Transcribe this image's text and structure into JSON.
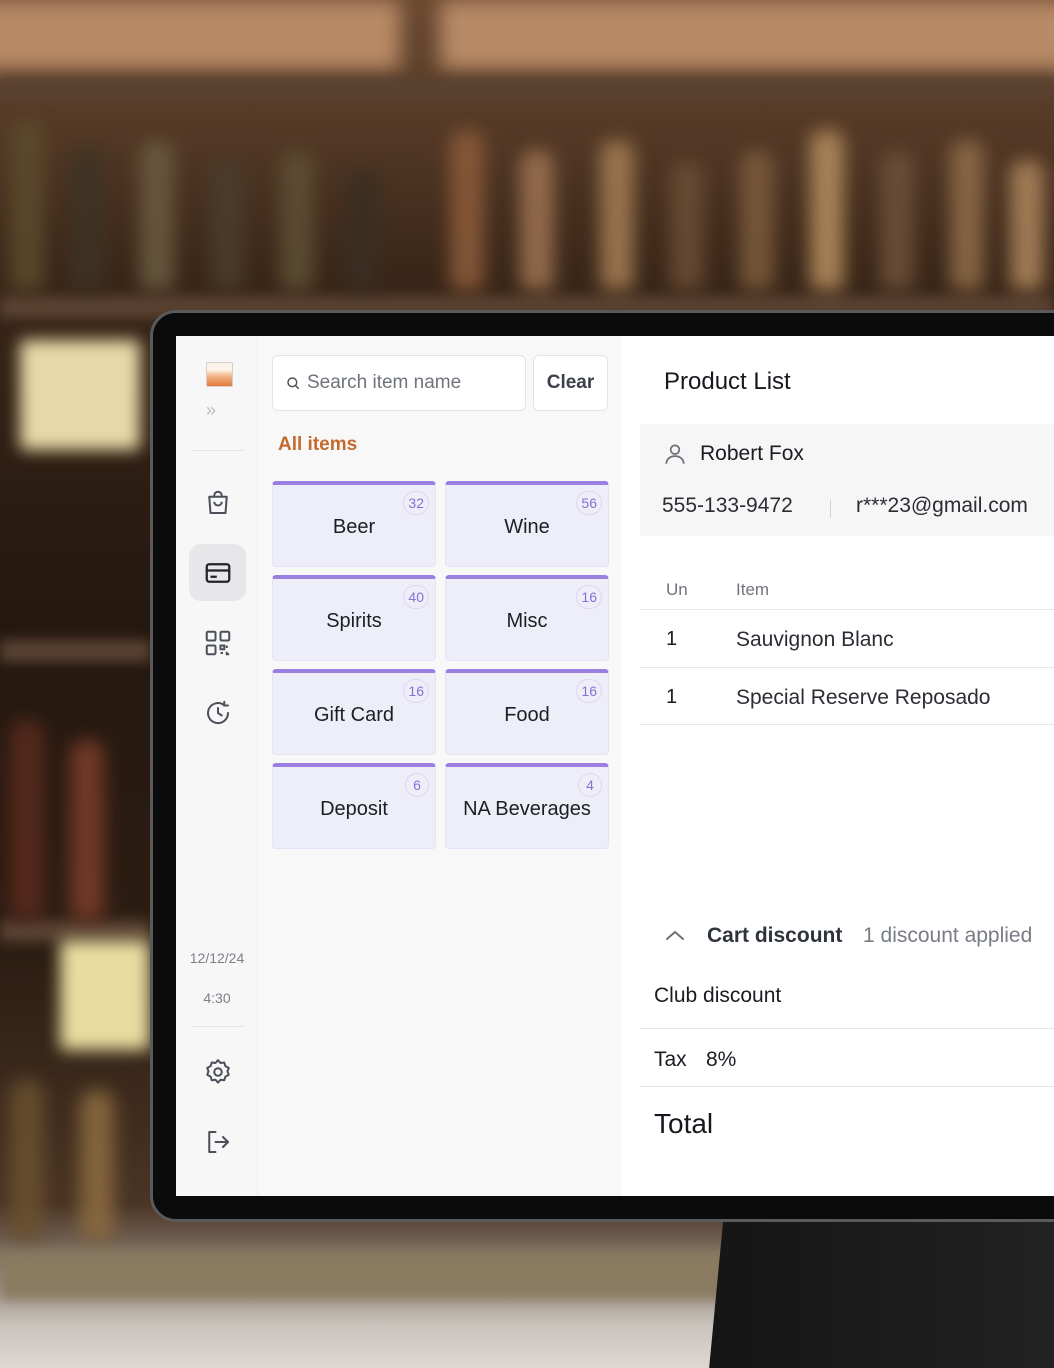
{
  "colors": {
    "accent_orange": "#c56a2e",
    "tile_border_purple": "#9a7fe0",
    "tile_bg": "#eeeef8",
    "badge_text": "#8a6fd6"
  },
  "rail": {
    "logo": "app-logo",
    "expand_glyph": "»",
    "icons": [
      "shopping-bag-icon",
      "card-icon",
      "qr-code-icon",
      "history-icon",
      "settings-icon",
      "logout-icon"
    ],
    "date": "12/12/24",
    "time": "4:30"
  },
  "catalog": {
    "search_placeholder": "Search item name",
    "clear_label": "Clear",
    "section_label": "All items",
    "categories": [
      {
        "name": "Beer",
        "count": "32"
      },
      {
        "name": "Wine",
        "count": "56"
      },
      {
        "name": "Spirits",
        "count": "40"
      },
      {
        "name": "Misc",
        "count": "16"
      },
      {
        "name": "Gift Card",
        "count": "16"
      },
      {
        "name": "Food",
        "count": "16"
      },
      {
        "name": "Deposit",
        "count": "6"
      },
      {
        "name": "NA Beverages",
        "count": "4"
      }
    ]
  },
  "product_list": {
    "title": "Product List",
    "customer": {
      "name": "Robert Fox",
      "phone": "555-133-9472",
      "email": "r***23@gmail.com"
    },
    "columns": [
      "Un",
      "Item"
    ],
    "rows": [
      {
        "un": "1",
        "item": "Sauvignon Blanc"
      },
      {
        "un": "1",
        "item": "Special Reserve Reposado"
      }
    ],
    "cart_discount_label": "Cart discount",
    "cart_discount_status": "1 discount applied",
    "club_discount_label": "Club discount",
    "tax_label": "Tax",
    "tax_value": "8%",
    "total_label": "Total"
  }
}
